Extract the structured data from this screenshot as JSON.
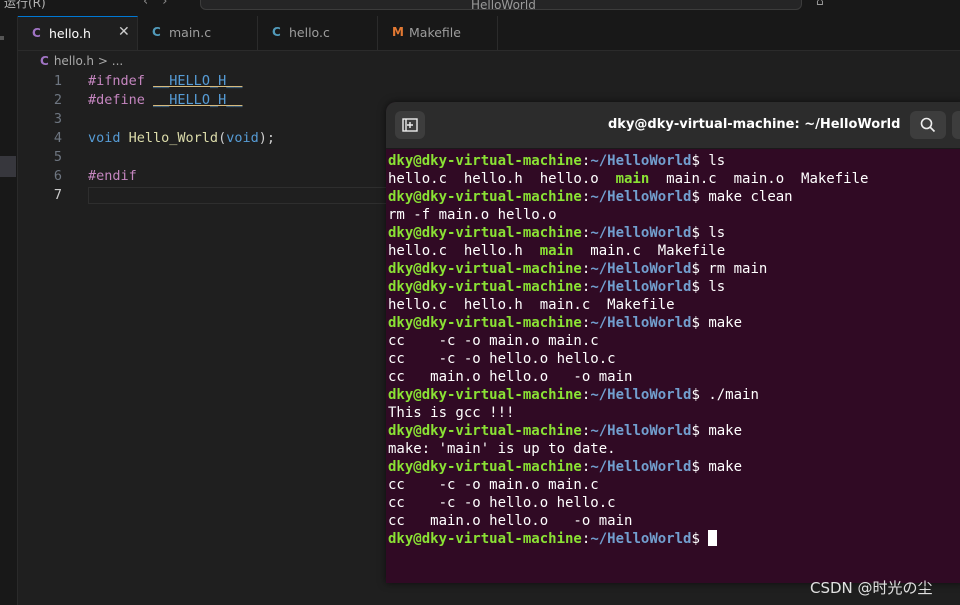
{
  "topbar": {
    "menu_fragment": "运行(R)",
    "command_center": "HelloWorld"
  },
  "tabs": [
    {
      "label": "hello.h",
      "icon": "C",
      "active": true
    },
    {
      "label": "main.c",
      "icon": "C",
      "active": false
    },
    {
      "label": "hello.c",
      "icon": "C",
      "active": false
    },
    {
      "label": "Makefile",
      "icon": "M",
      "active": false
    }
  ],
  "breadcrumb": {
    "file": "hello.h",
    "separator": ">",
    "rest": "..."
  },
  "editor": {
    "lines": [
      {
        "n": "1",
        "d": "#ifndef",
        "m": "__HELLO_H__"
      },
      {
        "n": "2",
        "d": "#define",
        "m": "__HELLO_H__"
      },
      {
        "n": "3"
      },
      {
        "n": "4",
        "t1": "void",
        "f": "Hello_World",
        "p1": "(",
        "t2": "void",
        "p2": ");"
      },
      {
        "n": "5"
      },
      {
        "n": "6",
        "d": "#endif"
      },
      {
        "n": "7"
      }
    ]
  },
  "terminal": {
    "title": "dky@dky-virtual-machine: ~/HelloWorld",
    "prompt_user": "dky@dky-virtual-machine",
    "prompt_colon": ":",
    "prompt_dir": "~/HelloWorld",
    "prompt_dollar": "$",
    "lines": [
      "$ ls",
      "hello.c  hello.h  hello.o  ",
      "main",
      "  main.c  main.o  Makefile",
      "$ make clean",
      "rm -f main.o hello.o",
      "$ ls",
      "hello.c  hello.h  ",
      "main",
      "  main.c  Makefile",
      "$ rm main",
      "$ ls",
      "hello.c  hello.h  main.c  Makefile",
      "$ make",
      "cc    -c -o main.o main.c",
      "cc    -c -o hello.o hello.c",
      "cc   main.o hello.o   -o main",
      "$ ./main",
      "This is gcc !!!",
      "$ make",
      "make: 'main' is up to date.",
      "$ make",
      "cc    -c -o main.o main.c",
      "cc    -c -o hello.o hello.c",
      "cc   main.o hello.o   -o main",
      "$ "
    ]
  },
  "watermark": "CSDN @时光の尘",
  "colors": {
    "terminal_bg": "#300a24",
    "prompt_user": "#8ae234",
    "prompt_dir": "#729fcf",
    "editor_bg": "#1f1f1f",
    "active_tab_border": "#0078d4"
  },
  "icons": {
    "new_tab": "new-tab-icon",
    "search": "search-icon",
    "close": "close-icon"
  }
}
